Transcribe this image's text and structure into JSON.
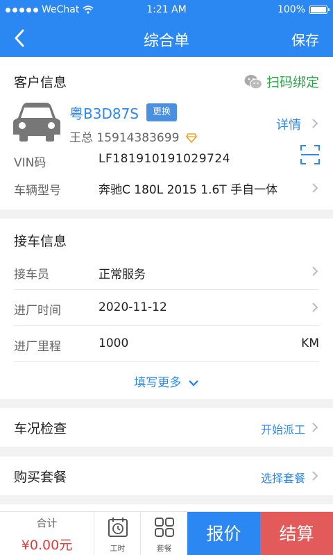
{
  "status_bar": {
    "carrier": "WeChat",
    "time": "1:21 AM",
    "battery": "100%"
  },
  "nav": {
    "title": "综合单",
    "save_label": "保存"
  },
  "customer": {
    "section_title": "客户信息",
    "bind_label": "扫码绑定",
    "plate": "粤B3D87S",
    "swap_label": "更换",
    "owner": "王总 15914383699",
    "detail_label": "详情",
    "vin_label": "VIN码",
    "vin_value": "LF181910191029724",
    "model_label": "车辆型号",
    "model_value": "奔驰C 180L 2015 1.6T 手自一体"
  },
  "pickup": {
    "section_title": "接车信息",
    "receptionist_label": "接车员",
    "receptionist_value": "正常服务",
    "entry_time_label": "进厂时间",
    "entry_time_value": "2020-11-12",
    "mileage_label": "进厂里程",
    "mileage_value": "1000",
    "mileage_unit": "KM",
    "more_label": "填写更多"
  },
  "inspection": {
    "title": "车况检查",
    "action": "开始派工"
  },
  "package": {
    "title": "购买套餐",
    "action": "选择套餐"
  },
  "bottom": {
    "total_label": "合计",
    "total_amount": "¥0.00元",
    "labor_label": "工时",
    "package_label": "套餐",
    "quote_label": "报价",
    "settle_label": "结算"
  },
  "colors": {
    "primary": "#2b87f2",
    "settle": "#e35a5a",
    "wechat_green": "#2aa847",
    "price_red": "#e23b3b"
  }
}
